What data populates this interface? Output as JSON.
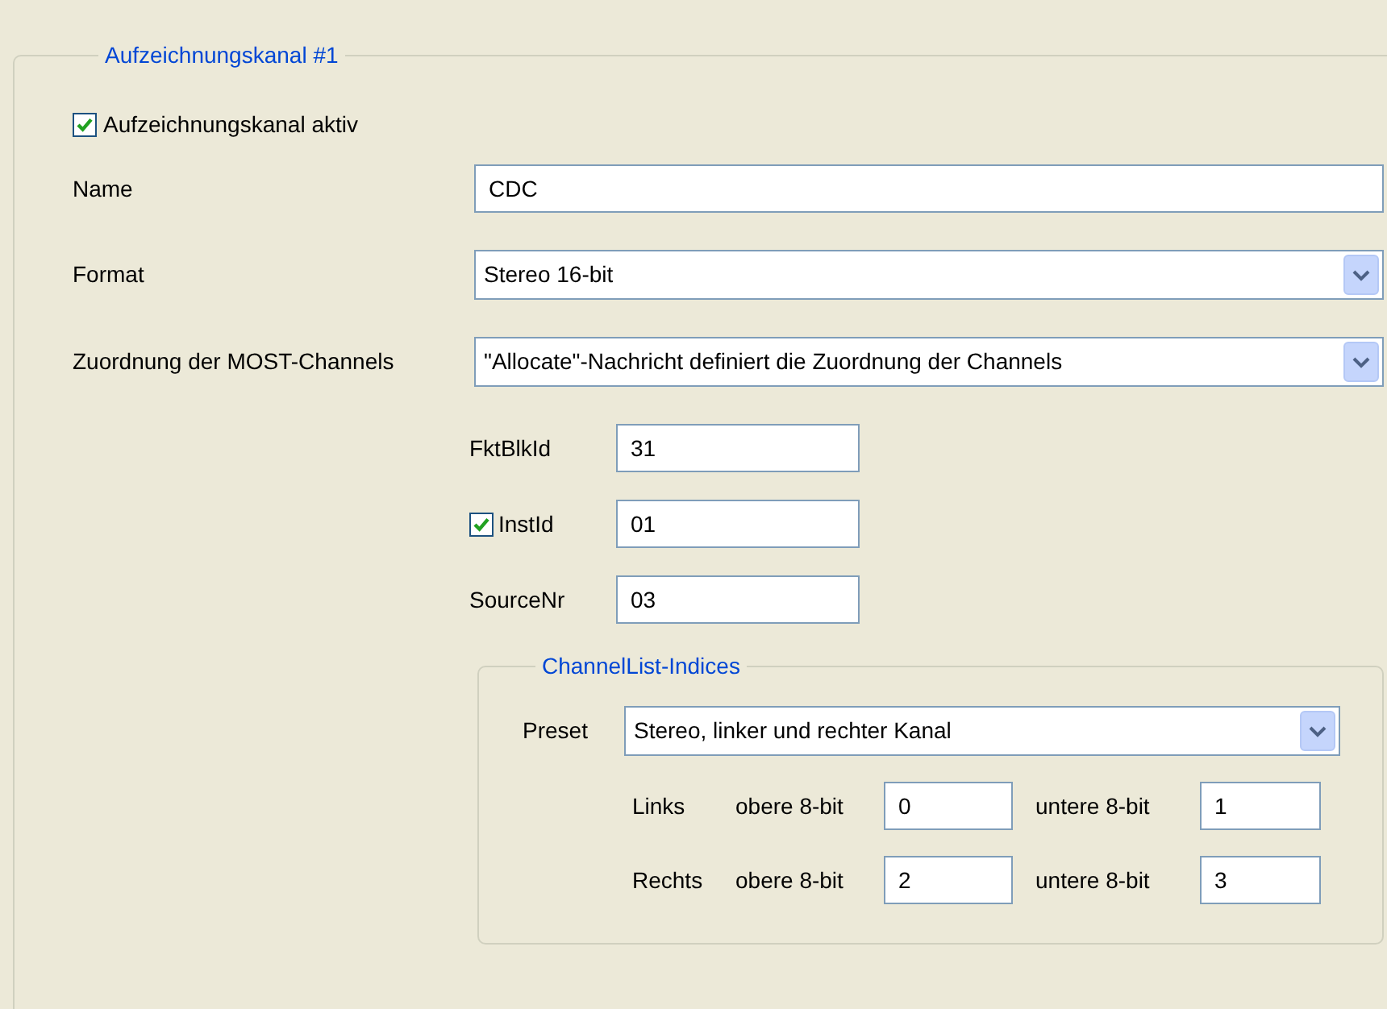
{
  "group": {
    "title": "Aufzeichnungskanal #1"
  },
  "active": {
    "label": "Aufzeichnungskanal aktiv",
    "checked": true
  },
  "fields": [
    {
      "kind": "text",
      "label": "Name",
      "value": "CDC"
    },
    {
      "kind": "select",
      "label": "Format",
      "value": "Stereo 16-bit"
    },
    {
      "kind": "select",
      "label": "Zuordnung der MOST-Channels",
      "value": "\"Allocate\"-Nachricht definiert die Zuordnung der Channels"
    }
  ],
  "ids": [
    {
      "kind": "plain",
      "label": "FktBlkId",
      "value": "31"
    },
    {
      "kind": "checkbox",
      "label": "InstId",
      "value": "01",
      "checked": true
    },
    {
      "kind": "plain",
      "label": "SourceNr",
      "value": "03"
    }
  ],
  "channel_list": {
    "title": "ChannelList-Indices",
    "preset": {
      "label": "Preset",
      "value": "Stereo, linker und rechter Kanal"
    },
    "rows": [
      {
        "label": "Links",
        "upper_label": "obere 8-bit",
        "upper": "0",
        "lower_label": "untere 8-bit",
        "lower": "1"
      },
      {
        "label": "Rechts",
        "upper_label": "obere 8-bit",
        "upper": "2",
        "lower_label": "untere 8-bit",
        "lower": "3"
      }
    ]
  }
}
